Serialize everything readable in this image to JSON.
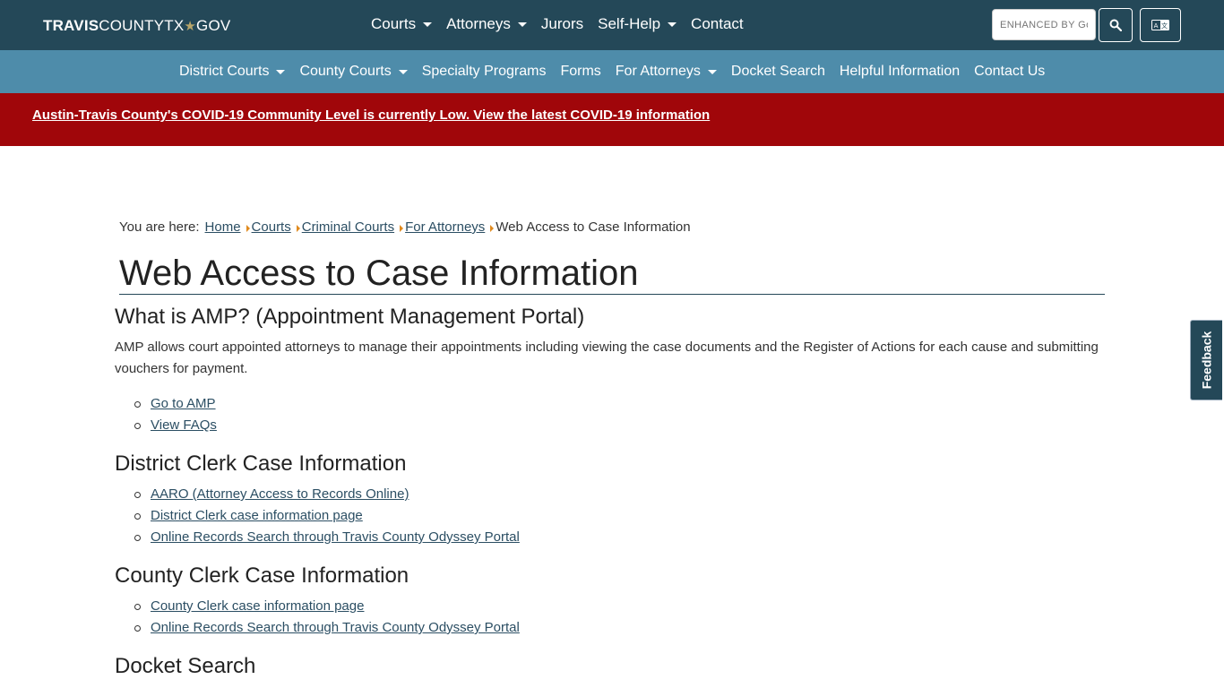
{
  "header": {
    "logo_bold": "TRAVIS",
    "logo_mid": "COUNTYTX",
    "logo_star": "★",
    "logo_end": "GOV",
    "nav": [
      {
        "label": "Courts",
        "dropdown": true
      },
      {
        "label": "Attorneys",
        "dropdown": true
      },
      {
        "label": "Jurors",
        "dropdown": false
      },
      {
        "label": "Self-Help",
        "dropdown": true
      },
      {
        "label": "Contact",
        "dropdown": false
      }
    ],
    "search_placeholder": "ENHANCED BY Google",
    "search_icon": "search-icon",
    "translate_icon": "translate-icon"
  },
  "subnav": [
    {
      "label": "District Courts",
      "dropdown": true
    },
    {
      "label": "County Courts",
      "dropdown": true
    },
    {
      "label": "Specialty Programs",
      "dropdown": false
    },
    {
      "label": "Forms",
      "dropdown": false
    },
    {
      "label": "For Attorneys",
      "dropdown": true
    },
    {
      "label": "Docket Search",
      "dropdown": false
    },
    {
      "label": "Helpful Information",
      "dropdown": false
    },
    {
      "label": "Contact Us",
      "dropdown": false
    }
  ],
  "alert": {
    "text": "Austin-Travis County's COVID-19 Community Level is currently Low. View the latest COVID-19 information"
  },
  "breadcrumb": {
    "label": "You are here:",
    "items": [
      "Home",
      "Courts",
      "Criminal Courts",
      "For Attorneys"
    ],
    "current": "Web Access to Case Information"
  },
  "page": {
    "title": "Web Access to Case Information",
    "sections": {
      "amp": {
        "heading": "What is AMP? (Appointment Management Portal)",
        "description": "AMP allows court appointed attorneys to manage their appointments including viewing the case documents and the Register of Actions for each cause and submitting vouchers for payment.",
        "links": [
          "Go to AMP",
          "View FAQs"
        ]
      },
      "district": {
        "heading": "District Clerk Case Information",
        "links": [
          "AARO (Attorney Access to Records Online)",
          "District Clerk case information page",
          "Online Records Search through Travis County Odyssey Portal"
        ]
      },
      "county": {
        "heading": "County Clerk Case Information",
        "links": [
          "County Clerk case information page",
          "Online Records Search through Travis County Odyssey Portal"
        ]
      },
      "docket": {
        "heading": "Docket Search"
      }
    }
  },
  "feedback": {
    "label": "Feedback"
  },
  "colors": {
    "topbar": "#244858",
    "subnav": "#4e8caa",
    "alert": "#a0060a",
    "link": "#2b4e63",
    "breadcrumb_sep": "#e08a1e"
  }
}
